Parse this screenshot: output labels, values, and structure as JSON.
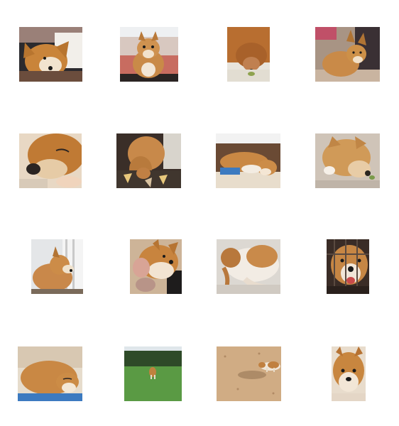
{
  "sticker_grid": {
    "items": [
      {
        "name": "sticker-corgi-lying-head-tilt"
      },
      {
        "name": "sticker-corgi-sitting-blanket"
      },
      {
        "name": "sticker-corgi-sniffing-down"
      },
      {
        "name": "sticker-corgi-lying-floor"
      },
      {
        "name": "sticker-corgi-face-closeup-sleepy"
      },
      {
        "name": "sticker-corgi-sitting-rug"
      },
      {
        "name": "sticker-corgi-lying-bed"
      },
      {
        "name": "sticker-corgi-eating-floor"
      },
      {
        "name": "sticker-corgi-window-side"
      },
      {
        "name": "sticker-corgi-grin-closeup"
      },
      {
        "name": "sticker-corgi-belly-up"
      },
      {
        "name": "sticker-corgi-behind-bars"
      },
      {
        "name": "sticker-corgi-sleeping-cushion"
      },
      {
        "name": "sticker-corgi-running-field"
      },
      {
        "name": "sticker-corgi-walking-sand"
      },
      {
        "name": "sticker-corgi-face-peek"
      }
    ]
  }
}
